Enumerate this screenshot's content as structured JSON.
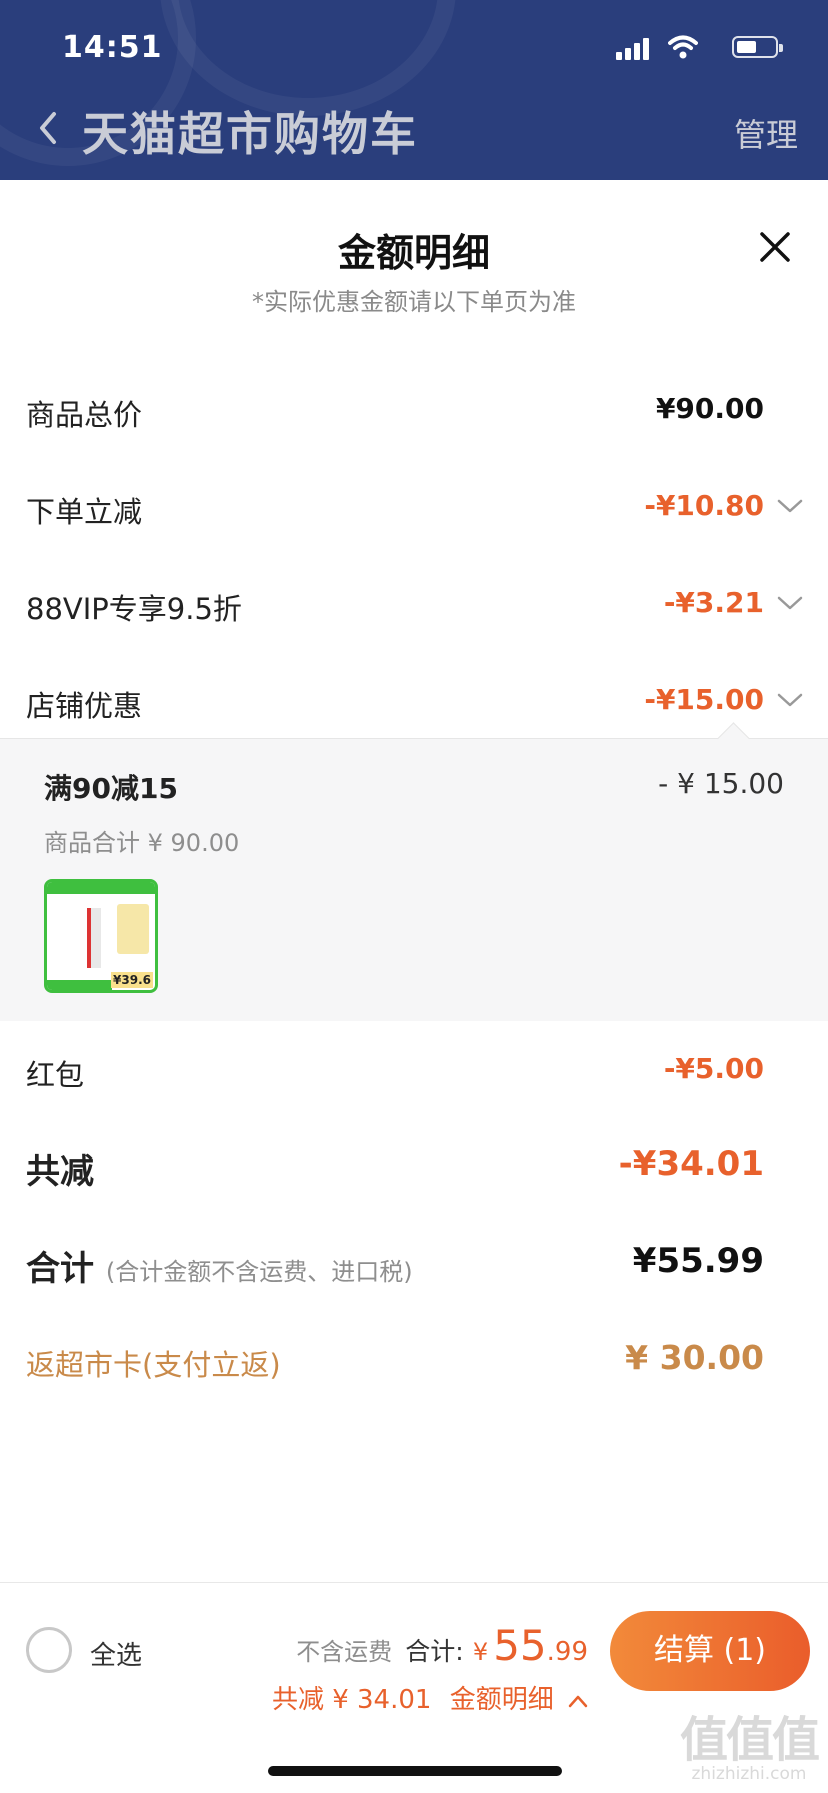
{
  "status_bar": {
    "time": "14:51"
  },
  "nav": {
    "title": "天猫超市购物车",
    "manage": "管理"
  },
  "sheet": {
    "title": "金额明细",
    "subtitle": "*实际优惠金额请以下单页为准"
  },
  "rows": [
    {
      "label": "商品总价",
      "value": "¥90.00"
    },
    {
      "label": "下单立减",
      "value": "-¥10.80"
    },
    {
      "label": "88VIP专享9.5折",
      "value": "-¥3.21"
    },
    {
      "label": "店铺优惠",
      "value": "-¥15.00"
    }
  ],
  "shop_promo": {
    "name": "满90减15",
    "amount": "- ¥ 15.00",
    "subtotal": "商品合计 ¥ 90.00",
    "thumb_price": "¥39.6"
  },
  "red_packet": {
    "label": "红包",
    "value": "-¥5.00"
  },
  "total_discount": {
    "label": "共减",
    "value": "-¥34.01"
  },
  "total": {
    "label": "合计",
    "note": "(合计金额不含运费、进口税)",
    "value": "¥55.99"
  },
  "cashback": {
    "label": "返超市卡(支付立返)",
    "value": "¥ 30.00"
  },
  "bottom_bar": {
    "select_all": "全选",
    "shipping_note": "不含运费",
    "total_label": "合计:",
    "currency": "¥",
    "total_int": "55",
    "total_dec": ".99",
    "discount_text": "共减 ¥ 34.01",
    "detail_link": "金额明细",
    "checkout": "结算 (1)"
  },
  "watermark": {
    "logo": "值值值",
    "url": "zhizhizhi.com"
  },
  "colors": {
    "header_bg": "#2a3e7c",
    "accent_orange": "#e8612c",
    "cashback_gold": "#c98a4a"
  }
}
